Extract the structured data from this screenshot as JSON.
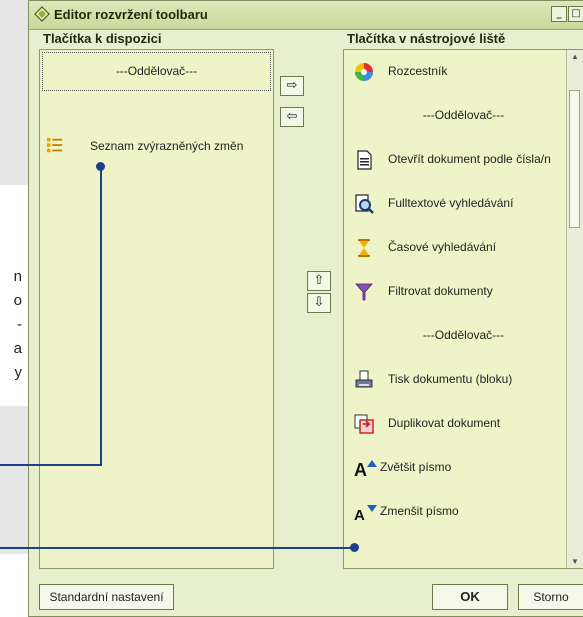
{
  "background_text": {
    "lines": [
      "n",
      "o",
      "-",
      "a",
      "y"
    ]
  },
  "window": {
    "title": "Editor rozvržení toolbaru",
    "min_label": "_",
    "max_label": "□",
    "close_label": "×"
  },
  "left_panel": {
    "header": "Tlačítka k dispozici",
    "items": [
      {
        "label": "---Oddělovač---",
        "icon": "none"
      },
      {
        "label": "Seznam zvýrazněných změn",
        "icon": "highlight-list-icon"
      }
    ]
  },
  "right_panel": {
    "header": "Tlačítka v nástrojové liště",
    "items": [
      {
        "label": "Rozcestník",
        "icon": "crossroads-icon"
      },
      {
        "label": "---Oddělovač---",
        "icon": "none"
      },
      {
        "label": "Otevřít dokument podle čísla/n",
        "icon": "document-icon"
      },
      {
        "label": "Fulltextové vyhledávání",
        "icon": "fulltext-search-icon"
      },
      {
        "label": "Časové vyhledávání",
        "icon": "hourglass-icon"
      },
      {
        "label": "Filtrovat dokumenty",
        "icon": "filter-icon"
      },
      {
        "label": "---Oddělovač---",
        "icon": "none"
      },
      {
        "label": "Tisk dokumentu (bloku)",
        "icon": "printer-icon"
      },
      {
        "label": "Duplikovat dokument",
        "icon": "duplicate-icon"
      },
      {
        "label": "Zvětšit písmo",
        "icon": "font-increase-icon"
      },
      {
        "label": "Zmenšit písmo",
        "icon": "font-decrease-icon"
      }
    ]
  },
  "buttons": {
    "move_right": "⇨",
    "move_left": "⇦",
    "move_up": "⇧",
    "move_down": "⇩",
    "defaults": "Standardní nastavení",
    "ok": "OK",
    "cancel": "Storno"
  },
  "colors": {
    "window_bg": "#e7efcf",
    "list_bg": "#eef4c8",
    "callout": "#1f3f8a"
  }
}
